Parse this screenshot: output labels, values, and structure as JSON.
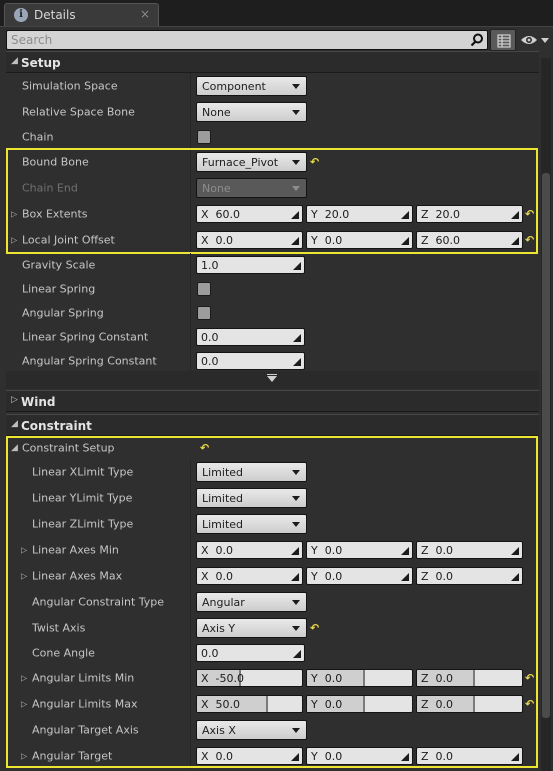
{
  "tab": {
    "title": "Details",
    "close": "×",
    "icon": "info-icon"
  },
  "search": {
    "placeholder": "Search"
  },
  "sections": {
    "setup": {
      "title": "Setup"
    },
    "wind": {
      "title": "Wind"
    },
    "constraint": {
      "title": "Constraint"
    }
  },
  "setup": {
    "simulation_space": {
      "label": "Simulation Space",
      "value": "Component"
    },
    "relative_space_bone": {
      "label": "Relative Space Bone",
      "value": "None"
    },
    "chain": {
      "label": "Chain",
      "checked": false
    },
    "bound_bone": {
      "label": "Bound Bone",
      "value": "Furnace_Pivot"
    },
    "chain_end": {
      "label": "Chain End",
      "value": "None"
    },
    "box_extents": {
      "label": "Box Extents",
      "x": "X  60.0",
      "y": "Y  20.0",
      "z": "Z  20.0"
    },
    "local_joint_offset": {
      "label": "Local Joint Offset",
      "x": "X  0.0",
      "y": "Y  0.0",
      "z": "Z  60.0"
    },
    "gravity_scale": {
      "label": "Gravity Scale",
      "value": "1.0"
    },
    "linear_spring": {
      "label": "Linear Spring",
      "checked": false
    },
    "angular_spring": {
      "label": "Angular Spring",
      "checked": false
    },
    "linear_spring_constant": {
      "label": "Linear Spring Constant",
      "value": "0.0"
    },
    "angular_spring_constant": {
      "label": "Angular Spring Constant",
      "value": "0.0"
    }
  },
  "constraint": {
    "setup_label": "Constraint Setup",
    "linear_xlimit": {
      "label": "Linear XLimit Type",
      "value": "Limited"
    },
    "linear_ylimit": {
      "label": "Linear YLimit Type",
      "value": "Limited"
    },
    "linear_zlimit": {
      "label": "Linear ZLimit Type",
      "value": "Limited"
    },
    "linear_axes_min": {
      "label": "Linear Axes Min",
      "x": "X  0.0",
      "y": "Y  0.0",
      "z": "Z  0.0"
    },
    "linear_axes_max": {
      "label": "Linear Axes Max",
      "x": "X  0.0",
      "y": "Y  0.0",
      "z": "Z  0.0"
    },
    "angular_constraint_type": {
      "label": "Angular Constraint Type",
      "value": "Angular"
    },
    "twist_axis": {
      "label": "Twist Axis",
      "value": "Axis Y"
    },
    "cone_angle": {
      "label": "Cone Angle",
      "value": "0.0"
    },
    "angular_limits_min": {
      "label": "Angular Limits Min",
      "x": "X  -50.0",
      "y": "Y  0.0",
      "z": "Z  0.0",
      "x_fill": 0.42,
      "y_fill": 0.55,
      "z_fill": 0.55
    },
    "angular_limits_max": {
      "label": "Angular Limits Max",
      "x": "X  50.0",
      "y": "Y  0.0",
      "z": "Z  0.0",
      "x_fill": 0.68,
      "y_fill": 0.55,
      "z_fill": 0.55
    },
    "angular_target_axis": {
      "label": "Angular Target Axis",
      "value": "Axis X"
    },
    "angular_target": {
      "label": "Angular Target",
      "x": "X  0.0",
      "y": "Y  0.0",
      "z": "Z  0.0"
    }
  },
  "colors": {
    "highlight": "#ece633",
    "reset_arrow": "#e8d84a",
    "panel": "#2f2f2f"
  }
}
